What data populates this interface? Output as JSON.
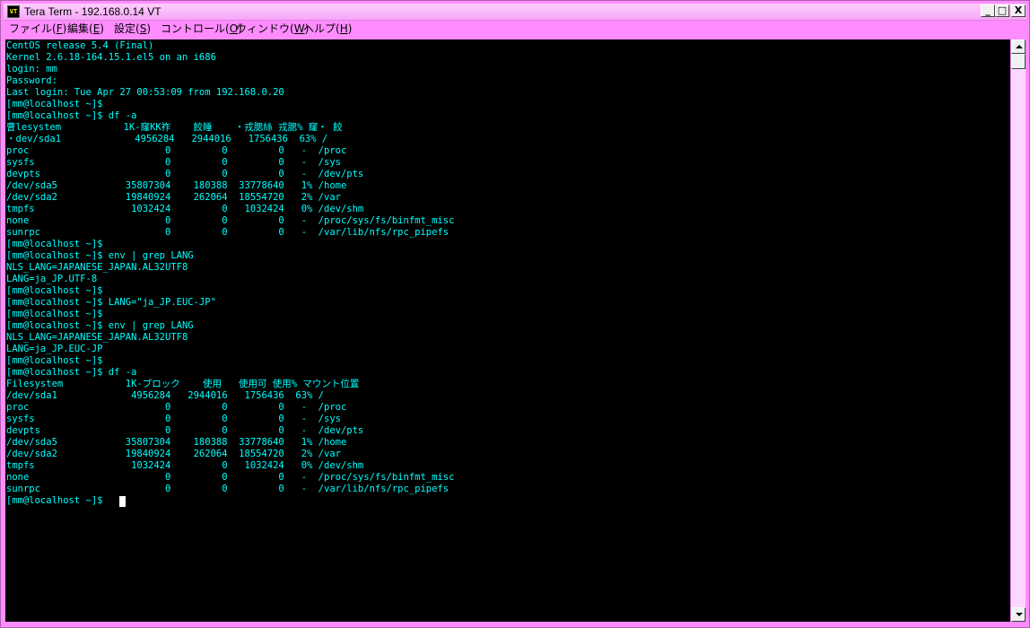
{
  "window": {
    "title": "Tera Term - 192.168.0.14 VT",
    "icon_text": "VT",
    "buttons": {
      "minimize": "_",
      "maximize": "□",
      "close": "X"
    }
  },
  "menu": [
    {
      "label": "ファイル(",
      "key": "F",
      "tail": ")"
    },
    {
      "label": "編集(",
      "key": "E",
      "tail": ")"
    },
    {
      "label": "設定(",
      "key": "S",
      "tail": ")"
    },
    {
      "label": "コントロール(",
      "key": "O",
      "tail": ")"
    },
    {
      "label": "ウィンドウ(",
      "key": "W",
      "tail": ")"
    },
    {
      "label": "ヘルプ(",
      "key": "H",
      "tail": ")"
    }
  ],
  "terminal": {
    "lines": [
      "CentOS release 5.4 (Final)",
      "Kernel 2.6.18-164.15.1.el5 on an i686",
      "login: mm",
      "Password:",
      "Last login: Tue Apr 27 00:53:09 from 192.168.0.20",
      "[mm@localhost ~]$",
      "[mm@localhost ~]$ df -a",
      "曹lesystem           1K-窿KK祚    餃睡    ・戎腮絲 戎腮% 窿・ 餃",
      "・dev/sda1             4956284   2944016   1756436  63% /",
      "proc                        0         0         0   -  /proc",
      "sysfs                       0         0         0   -  /sys",
      "devpts                      0         0         0   -  /dev/pts",
      "/dev/sda5            35807304    180388  33778640   1% /home",
      "/dev/sda2            19840924    262064  18554720   2% /var",
      "tmpfs                 1032424         0   1032424   0% /dev/shm",
      "none                        0         0         0   -  /proc/sys/fs/binfmt_misc",
      "sunrpc                      0         0         0   -  /var/lib/nfs/rpc_pipefs",
      "[mm@localhost ~]$",
      "[mm@localhost ~]$ env | grep LANG",
      "NLS_LANG=JAPANESE_JAPAN.AL32UTF8",
      "LANG=ja_JP.UTF-8",
      "[mm@localhost ~]$",
      "[mm@localhost ~]$ LANG=\"ja_JP.EUC-JP\"",
      "[mm@localhost ~]$",
      "[mm@localhost ~]$ env | grep LANG",
      "NLS_LANG=JAPANESE_JAPAN.AL32UTF8",
      "LANG=ja_JP.EUC-JP",
      "[mm@localhost ~]$",
      "[mm@localhost ~]$ df -a",
      "Filesystem           1K-ブロック    使用   使用可 使用% マウント位置",
      "/dev/sda1             4956284   2944016   1756436  63% /",
      "proc                        0         0         0   -  /proc",
      "sysfs                       0         0         0   -  /sys",
      "devpts                      0         0         0   -  /dev/pts",
      "/dev/sda5            35807304    180388  33778640   1% /home",
      "/dev/sda2            19840924    262064  18554720   2% /var",
      "tmpfs                 1032424         0   1032424   0% /dev/shm",
      "none                        0         0         0   -  /proc/sys/fs/binfmt_misc",
      "sunrpc                      0         0         0   -  /var/lib/nfs/rpc_pipefs",
      "[mm@localhost ~]$ "
    ]
  },
  "colors": {
    "chrome": "#ff8cff",
    "terminal_bg": "#000000",
    "terminal_fg": "#00ffff",
    "cursor": "#ffffff"
  }
}
